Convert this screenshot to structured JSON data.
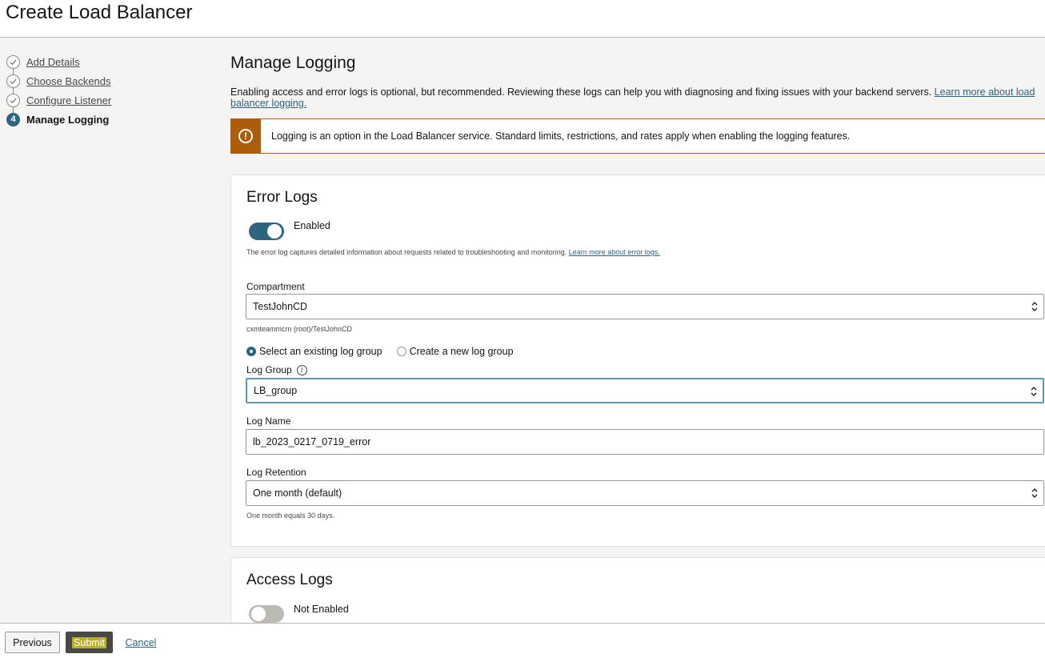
{
  "page": {
    "title": "Create Load Balancer"
  },
  "steps": [
    {
      "label": "Add Details",
      "state": "done"
    },
    {
      "label": "Choose Backends",
      "state": "done"
    },
    {
      "label": "Configure Listener",
      "state": "done"
    },
    {
      "label": "Manage Logging",
      "state": "current",
      "number": "4"
    }
  ],
  "main": {
    "title": "Manage Logging",
    "intro_text": "Enabling access and error logs is optional, but recommended. Reviewing these logs can help you with diagnosing and fixing issues with your backend servers. ",
    "intro_link": "Learn more about load balancer logging.",
    "warning_text": "Logging is an option in the Load Balancer service. Standard limits, restrictions, and rates apply when enabling the logging features."
  },
  "error_logs": {
    "title": "Error Logs",
    "toggle_label": "Enabled",
    "toggle_on": true,
    "help_text": "The error log captures detailed information about requests related to troubleshooting and monitoring. ",
    "help_link": "Learn more about error logs.",
    "compartment_label": "Compartment",
    "compartment_value": "TestJohnCD",
    "compartment_path": "cxmteammcrn (root)/TestJohnCD",
    "radio_existing": "Select an existing log group",
    "radio_new": "Create a new log group",
    "log_group_label": "Log Group",
    "log_group_value": "LB_group",
    "log_name_label": "Log Name",
    "log_name_value": "lb_2023_0217_0719_error",
    "retention_label": "Log Retention",
    "retention_value": "One month (default)",
    "retention_help": "One month equals 30 days."
  },
  "access_logs": {
    "title": "Access Logs",
    "toggle_label": "Not Enabled",
    "toggle_on": false
  },
  "footer": {
    "previous": "Previous",
    "submit": "Submit",
    "cancel": "Cancel"
  },
  "colors": {
    "accent": "#2e6480",
    "warning": "#ad5d0a",
    "focus": "#5c9baf",
    "highlight": "#b5b02d"
  }
}
